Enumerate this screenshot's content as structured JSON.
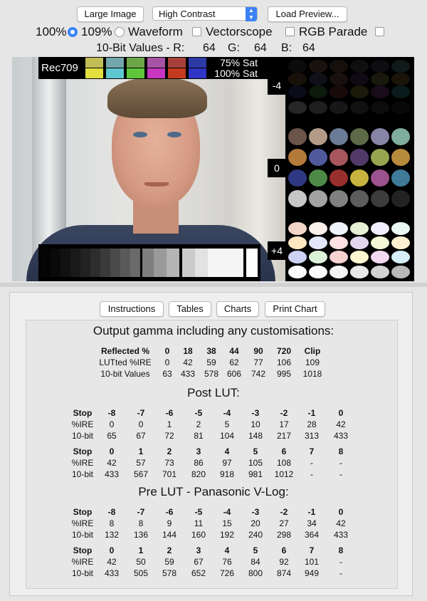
{
  "toolbar": {
    "large_image": "Large Image",
    "contrast_selected": "High Contrast",
    "load_preview": "Load Preview..."
  },
  "options": {
    "r100": "100%",
    "r109": "109%",
    "waveform": "Waveform",
    "vectorscope": "Vectorscope",
    "rgb_parade": "RGB Parade"
  },
  "values_row": {
    "label": "10-Bit Values - R:",
    "r": "64",
    "g_label": "G:",
    "g": "64",
    "b_label": "B:",
    "b": "64"
  },
  "viewer": {
    "rec_label": "Rec709",
    "sat75": "75% Sat",
    "sat100": "100% Sat",
    "ev_minus": "-4",
    "ev_zero": "0",
    "ev_plus": "+4",
    "colors": {
      "sat75": [
        "#c1bd57",
        "#73a7ac",
        "#6da649",
        "#a753a5",
        "#a7403d",
        "#2c3aa6"
      ],
      "sat100": [
        "#e2df3f",
        "#5fc6cf",
        "#5fc63a",
        "#c636c1",
        "#c43a1f",
        "#2f35c4"
      ]
    }
  },
  "tabs": {
    "instructions": "Instructions",
    "tables": "Tables",
    "charts": "Charts",
    "print_chart": "Print Chart"
  },
  "output": {
    "title": "Output gamma including any customisations:",
    "rows": [
      [
        "Reflected %",
        "0",
        "18",
        "38",
        "44",
        "90",
        "720",
        "Clip"
      ],
      [
        "LUTted %IRE",
        "0",
        "42",
        "59",
        "62",
        "77",
        "106",
        "109"
      ],
      [
        "10-bit Values",
        "63",
        "433",
        "578",
        "606",
        "742",
        "995",
        "1018"
      ]
    ]
  },
  "post_lut": {
    "title": "Post LUT:",
    "table1": [
      [
        "Stop",
        "-8",
        "-7",
        "-6",
        "-5",
        "-4",
        "-3",
        "-2",
        "-1",
        "0"
      ],
      [
        "%IRE",
        "0",
        "0",
        "1",
        "2",
        "5",
        "10",
        "17",
        "28",
        "42"
      ],
      [
        "10-bit",
        "65",
        "67",
        "72",
        "81",
        "104",
        "148",
        "217",
        "313",
        "433"
      ]
    ],
    "table2": [
      [
        "Stop",
        "0",
        "1",
        "2",
        "3",
        "4",
        "5",
        "6",
        "7",
        "8"
      ],
      [
        "%IRE",
        "42",
        "57",
        "73",
        "86",
        "97",
        "105",
        "108",
        "-",
        "-"
      ],
      [
        "10-bit",
        "433",
        "567",
        "701",
        "820",
        "918",
        "981",
        "1012",
        "-",
        "-"
      ]
    ]
  },
  "pre_lut": {
    "title": "Pre LUT - Panasonic V-Log:",
    "table1": [
      [
        "Stop",
        "-8",
        "-7",
        "-6",
        "-5",
        "-4",
        "-3",
        "-2",
        "-1",
        "0"
      ],
      [
        "%IRE",
        "8",
        "8",
        "9",
        "11",
        "15",
        "20",
        "27",
        "34",
        "42"
      ],
      [
        "10-bit",
        "132",
        "136",
        "144",
        "160",
        "192",
        "240",
        "298",
        "364",
        "433"
      ]
    ],
    "table2": [
      [
        "Stop",
        "0",
        "1",
        "2",
        "3",
        "4",
        "5",
        "6",
        "7",
        "8"
      ],
      [
        "%IRE",
        "42",
        "50",
        "59",
        "67",
        "76",
        "84",
        "92",
        "101",
        "-"
      ],
      [
        "10-bit",
        "433",
        "505",
        "578",
        "652",
        "726",
        "800",
        "874",
        "949",
        "-"
      ]
    ]
  }
}
